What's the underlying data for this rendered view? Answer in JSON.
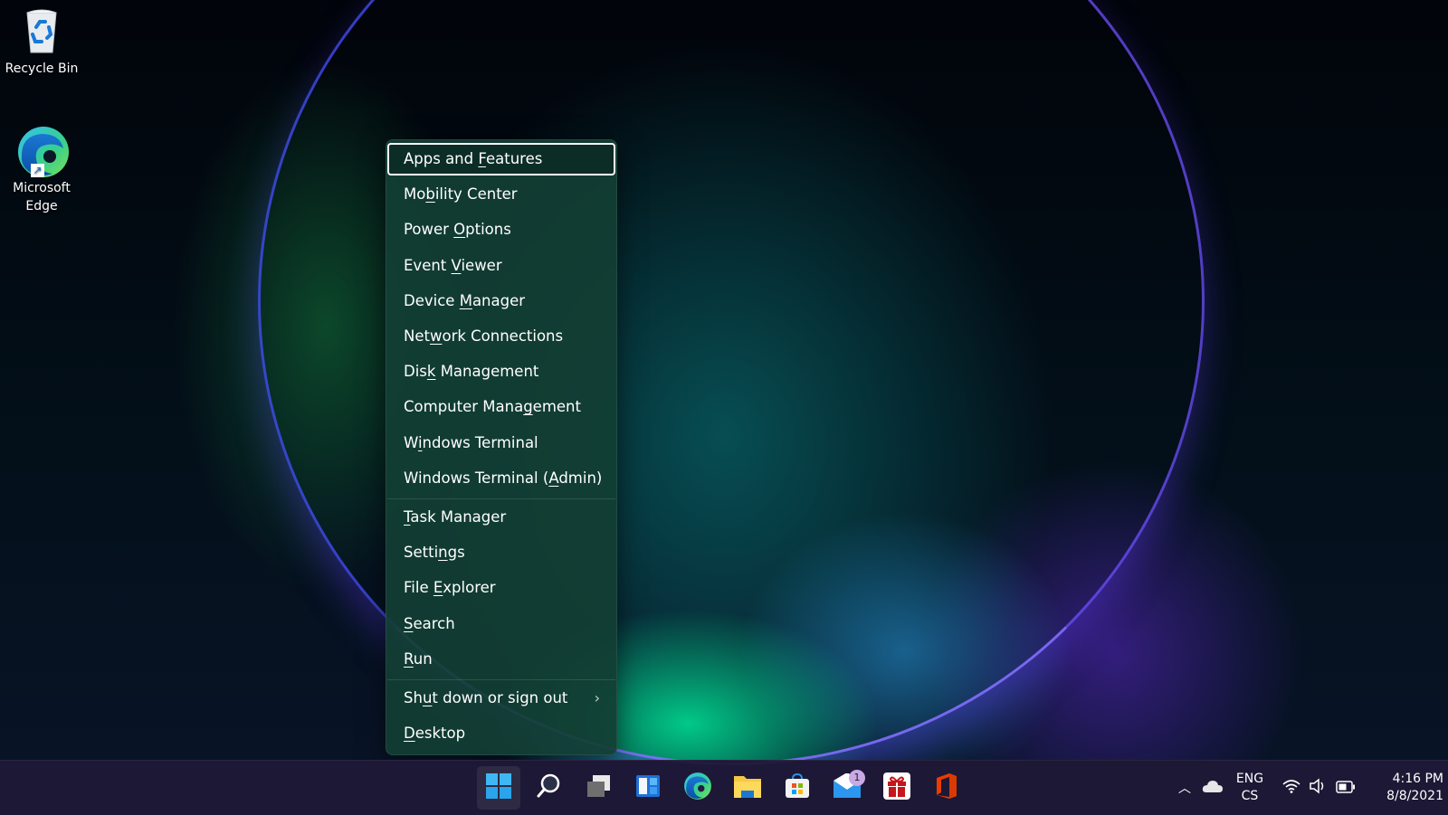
{
  "desktop": {
    "icons": [
      {
        "label": "Recycle Bin",
        "icon": "recycle-bin-icon"
      },
      {
        "label_line1": "Microsoft",
        "label_line2": "Edge",
        "icon": "edge-icon"
      }
    ]
  },
  "menu": {
    "groups": [
      [
        {
          "label": "Apps and Features",
          "pre": "Apps and ",
          "key": "F",
          "post": "eatures",
          "focused": true
        },
        {
          "label": "Mobility Center",
          "pre": "Mo",
          "key": "b",
          "post": "ility Center"
        },
        {
          "label": "Power Options",
          "pre": "Power ",
          "key": "O",
          "post": "ptions"
        },
        {
          "label": "Event Viewer",
          "pre": "Event ",
          "key": "V",
          "post": "iewer"
        },
        {
          "label": "Device Manager",
          "pre": "Device ",
          "key": "M",
          "post": "anager"
        },
        {
          "label": "Network Connections",
          "pre": "Net",
          "key": "w",
          "post": "ork Connections"
        },
        {
          "label": "Disk Management",
          "pre": "Dis",
          "key": "k",
          "post": " Management"
        },
        {
          "label": "Computer Management",
          "pre": "Computer Mana",
          "key": "g",
          "post": "ement"
        },
        {
          "label": "Windows Terminal",
          "pre": "W",
          "key": "i",
          "post": "ndows Terminal"
        },
        {
          "label": "Windows Terminal (Admin)",
          "pre": "Windows Terminal (",
          "key": "A",
          "post": "dmin)"
        }
      ],
      [
        {
          "label": "Task Manager",
          "pre": "",
          "key": "T",
          "post": "ask Manager"
        },
        {
          "label": "Settings",
          "pre": "Setti",
          "key": "n",
          "post": "gs"
        },
        {
          "label": "File Explorer",
          "pre": "File ",
          "key": "E",
          "post": "xplorer"
        },
        {
          "label": "Search",
          "pre": "",
          "key": "S",
          "post": "earch"
        },
        {
          "label": "Run",
          "pre": "",
          "key": "R",
          "post": "un"
        }
      ],
      [
        {
          "label": "Shut down or sign out",
          "pre": "Sh",
          "key": "u",
          "post": "t down or sign out",
          "submenu": true,
          "submenu_icon": "chevron-right-icon"
        },
        {
          "label": "Desktop",
          "pre": "",
          "key": "D",
          "post": "esktop"
        }
      ]
    ]
  },
  "taskbar": {
    "apps": [
      {
        "name": "start",
        "icon": "windows-start-icon",
        "active": true
      },
      {
        "name": "search",
        "icon": "search-icon"
      },
      {
        "name": "task-view",
        "icon": "task-view-icon"
      },
      {
        "name": "widgets",
        "icon": "widgets-icon"
      },
      {
        "name": "edge",
        "icon": "edge-icon"
      },
      {
        "name": "file-explorer",
        "icon": "folder-icon"
      },
      {
        "name": "microsoft-store",
        "icon": "store-icon"
      },
      {
        "name": "mail",
        "icon": "mail-icon",
        "badge": "1"
      },
      {
        "name": "gift",
        "icon": "gift-icon"
      },
      {
        "name": "office",
        "icon": "office-icon"
      }
    ],
    "tray": {
      "overflow_icon": "chevron-up-icon",
      "cloud_icon": "onedrive-icon",
      "language_line1": "ENG",
      "language_line2": "CS",
      "wifi_icon": "wifi-icon",
      "volume_icon": "volume-icon",
      "battery_icon": "battery-icon",
      "time": "4:16 PM",
      "date": "8/8/2021"
    }
  },
  "colors": {
    "accent": "#4cc2ff",
    "menu_bg": "#123e34",
    "taskbar_bg": "#1e1937",
    "badge": "#c9a9e6"
  }
}
